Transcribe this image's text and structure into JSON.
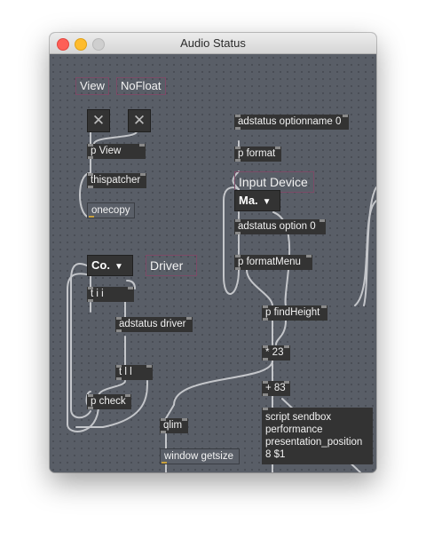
{
  "window": {
    "title": "Audio Status",
    "canvas_color": "#595e67",
    "object_color": "#333333",
    "cord_color": "#c4c6ca"
  },
  "patcher": {
    "comment_view": "View",
    "comment_nofloat": "NoFloat",
    "comment_input_device": "Input Device",
    "comment_driver": "Driver",
    "toggle_glyph": "✕",
    "obj_p_view": "p View",
    "obj_thispatcher": "thispatcher",
    "msg_onecopy": "onecopy",
    "obj_adstatus_optionname": "adstatus optionname 0",
    "obj_p_format": "p format",
    "umenu_ma": "Ma.",
    "obj_adstatus_option": "adstatus option 0",
    "obj_p_formatmenu": "p formatMenu",
    "umenu_co": "Co.",
    "umenu_arrow": "▼",
    "obj_tii": "t i i",
    "obj_adstatus_driver": "adstatus driver",
    "obj_tll": "t l l",
    "obj_p_check": "p check",
    "obj_p_findheight": "p findHeight",
    "obj_mult": "* 23",
    "obj_add": "+ 83",
    "obj_qlim": "qlim",
    "msg_window_getsize": "window getsize",
    "msg_script_lines": [
      "script sendbox",
      "performance",
      "presentation_position",
      "8 $1"
    ]
  }
}
